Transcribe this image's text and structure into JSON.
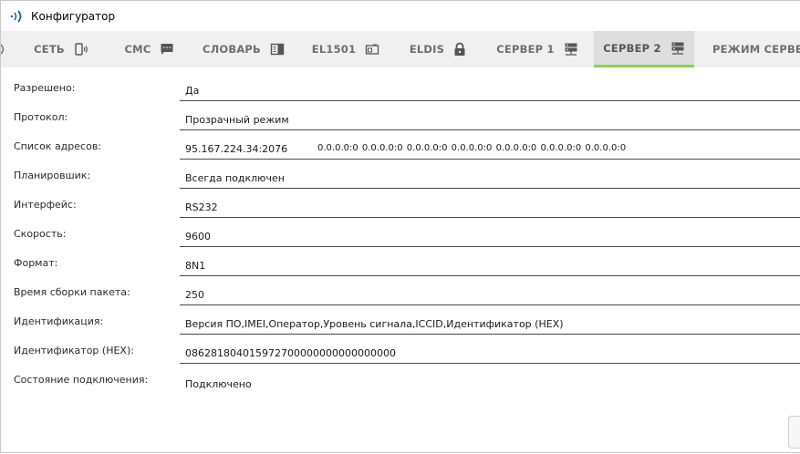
{
  "window": {
    "title": "Конфигуратор",
    "accent_color": "#8bd34a",
    "logo_color": "#1a5fb4"
  },
  "tabs": [
    {
      "label": "СЕТЬ",
      "icon": "phone-signal-icon",
      "active": false
    },
    {
      "label": "СМС",
      "icon": "message-icon",
      "active": false
    },
    {
      "label": "СЛОВАРЬ",
      "icon": "dictionary-icon",
      "active": false
    },
    {
      "label": "EL1501",
      "icon": "device-icon",
      "active": false
    },
    {
      "label": "ELDIS",
      "icon": "lock-icon",
      "active": false
    },
    {
      "label": "СЕРВЕР 1",
      "icon": "server-icon",
      "active": false
    },
    {
      "label": "СЕРВЕР 2",
      "icon": "server-icon",
      "active": true
    },
    {
      "label": "РЕЖИМ СЕРВЕР",
      "icon": "",
      "active": false
    }
  ],
  "fields": [
    {
      "label": "Разрешено:",
      "value": "Да"
    },
    {
      "label": "Протокол:",
      "value": "Прозрачный режим"
    },
    {
      "label": "Список адресов:",
      "value": "95.167.224.34:2076",
      "extra": "0.0.0.0:0  0.0.0.0:0  0.0.0.0:0  0.0.0.0:0  0.0.0.0:0  0.0.0.0:0  0.0.0.0:0"
    },
    {
      "label": "Планировшик:",
      "value": "Всегда подключен"
    },
    {
      "label": "Интерфейс:",
      "value": "RS232"
    },
    {
      "label": "Скорость:",
      "value": "9600"
    },
    {
      "label": "Формат:",
      "value": "8N1"
    },
    {
      "label": "Время сборки пакета:",
      "value": "250"
    },
    {
      "label": "Идентификация:",
      "value": "Версия ПО,IMEI,Оператор,Уровень сигнала,ICCID,Идентификатор (HEX)"
    },
    {
      "label": "Идентификатор (HEX):",
      "value": "086281804015972700000000000000000"
    },
    {
      "label": "Состояние подключения:",
      "value": "Подключено"
    }
  ]
}
